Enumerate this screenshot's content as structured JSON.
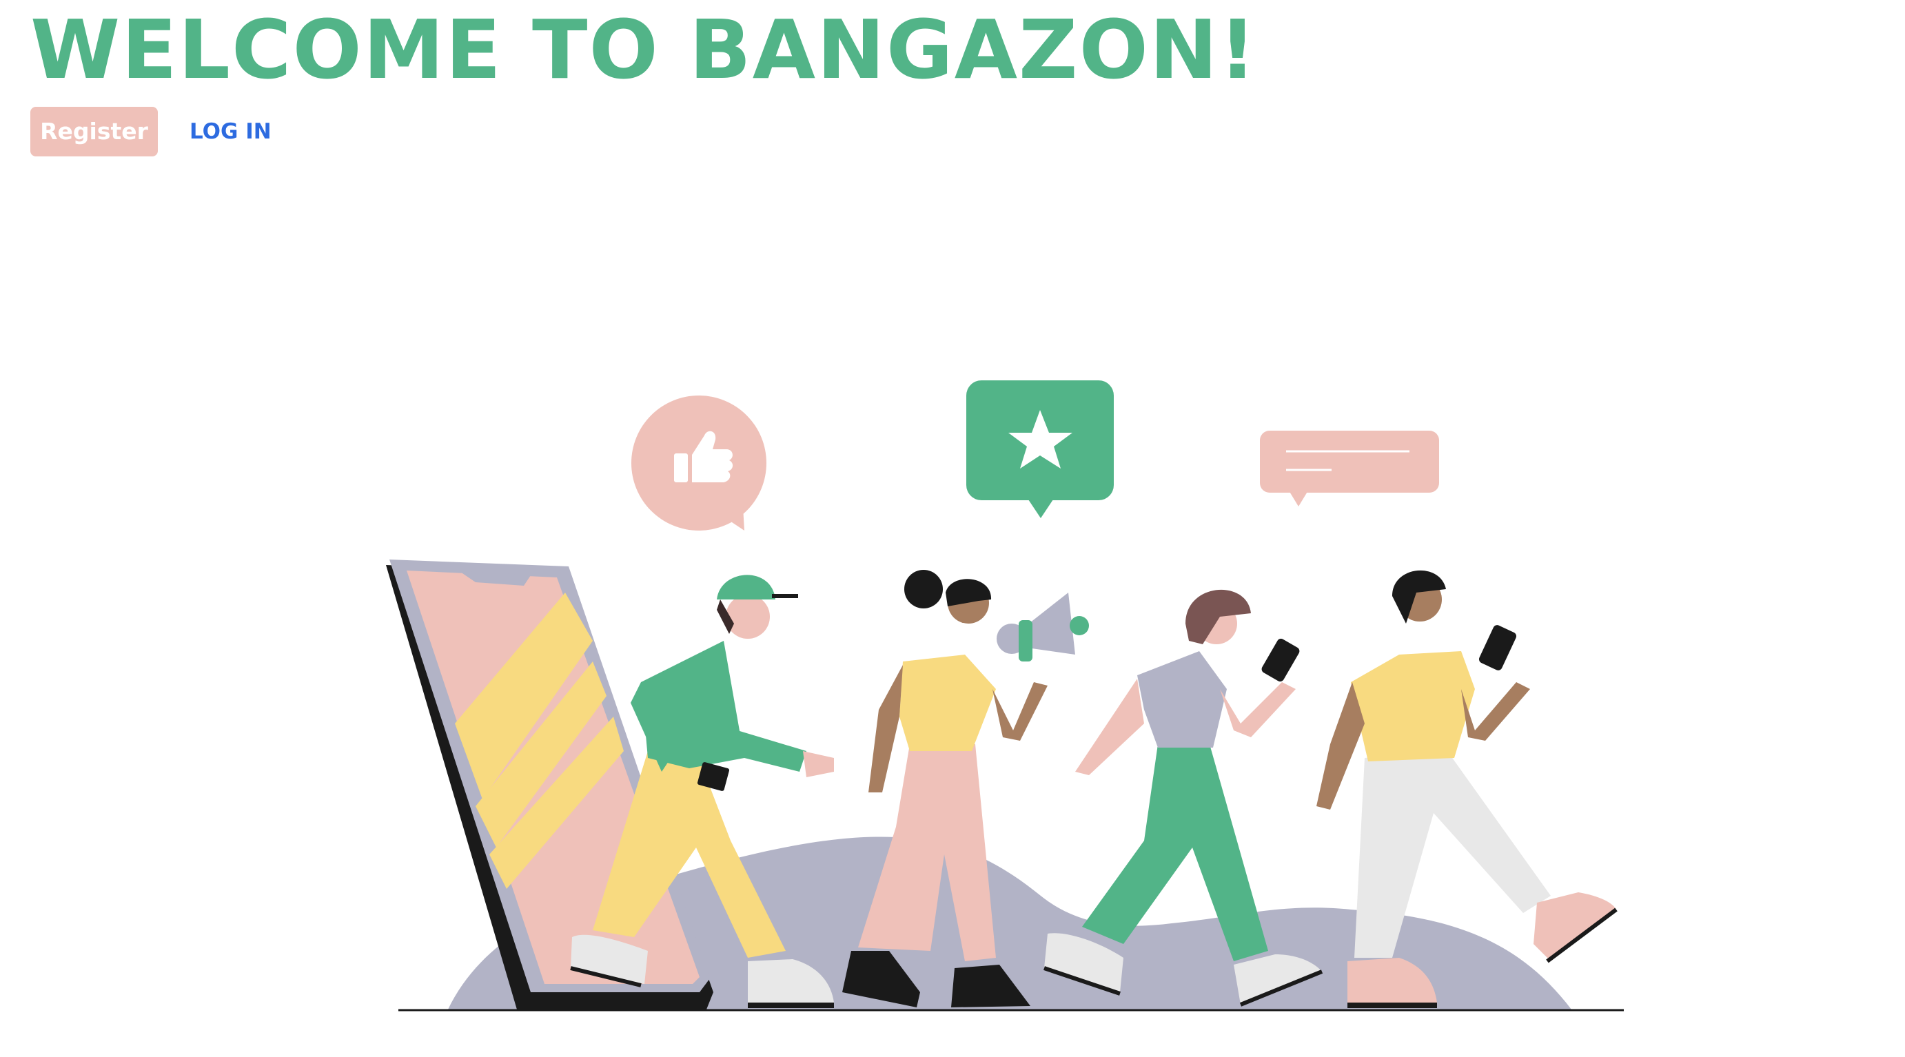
{
  "header": {
    "title": "WELCOME TO BANGAZON!"
  },
  "auth": {
    "register_label": "Register",
    "login_label": "LOG IN"
  },
  "colors": {
    "brand_green": "#52b488",
    "register_bg": "#efc1b9",
    "login_link": "#2d6be0",
    "pink": "#efc1b9",
    "yellow": "#f8da80",
    "lavender": "#b2b3c6",
    "dark": "#1a1a1a"
  },
  "illustration": {
    "icons": [
      "thumbs-up-icon",
      "star-icon",
      "message-lines-icon",
      "megaphone-icon",
      "phone-icon"
    ]
  }
}
